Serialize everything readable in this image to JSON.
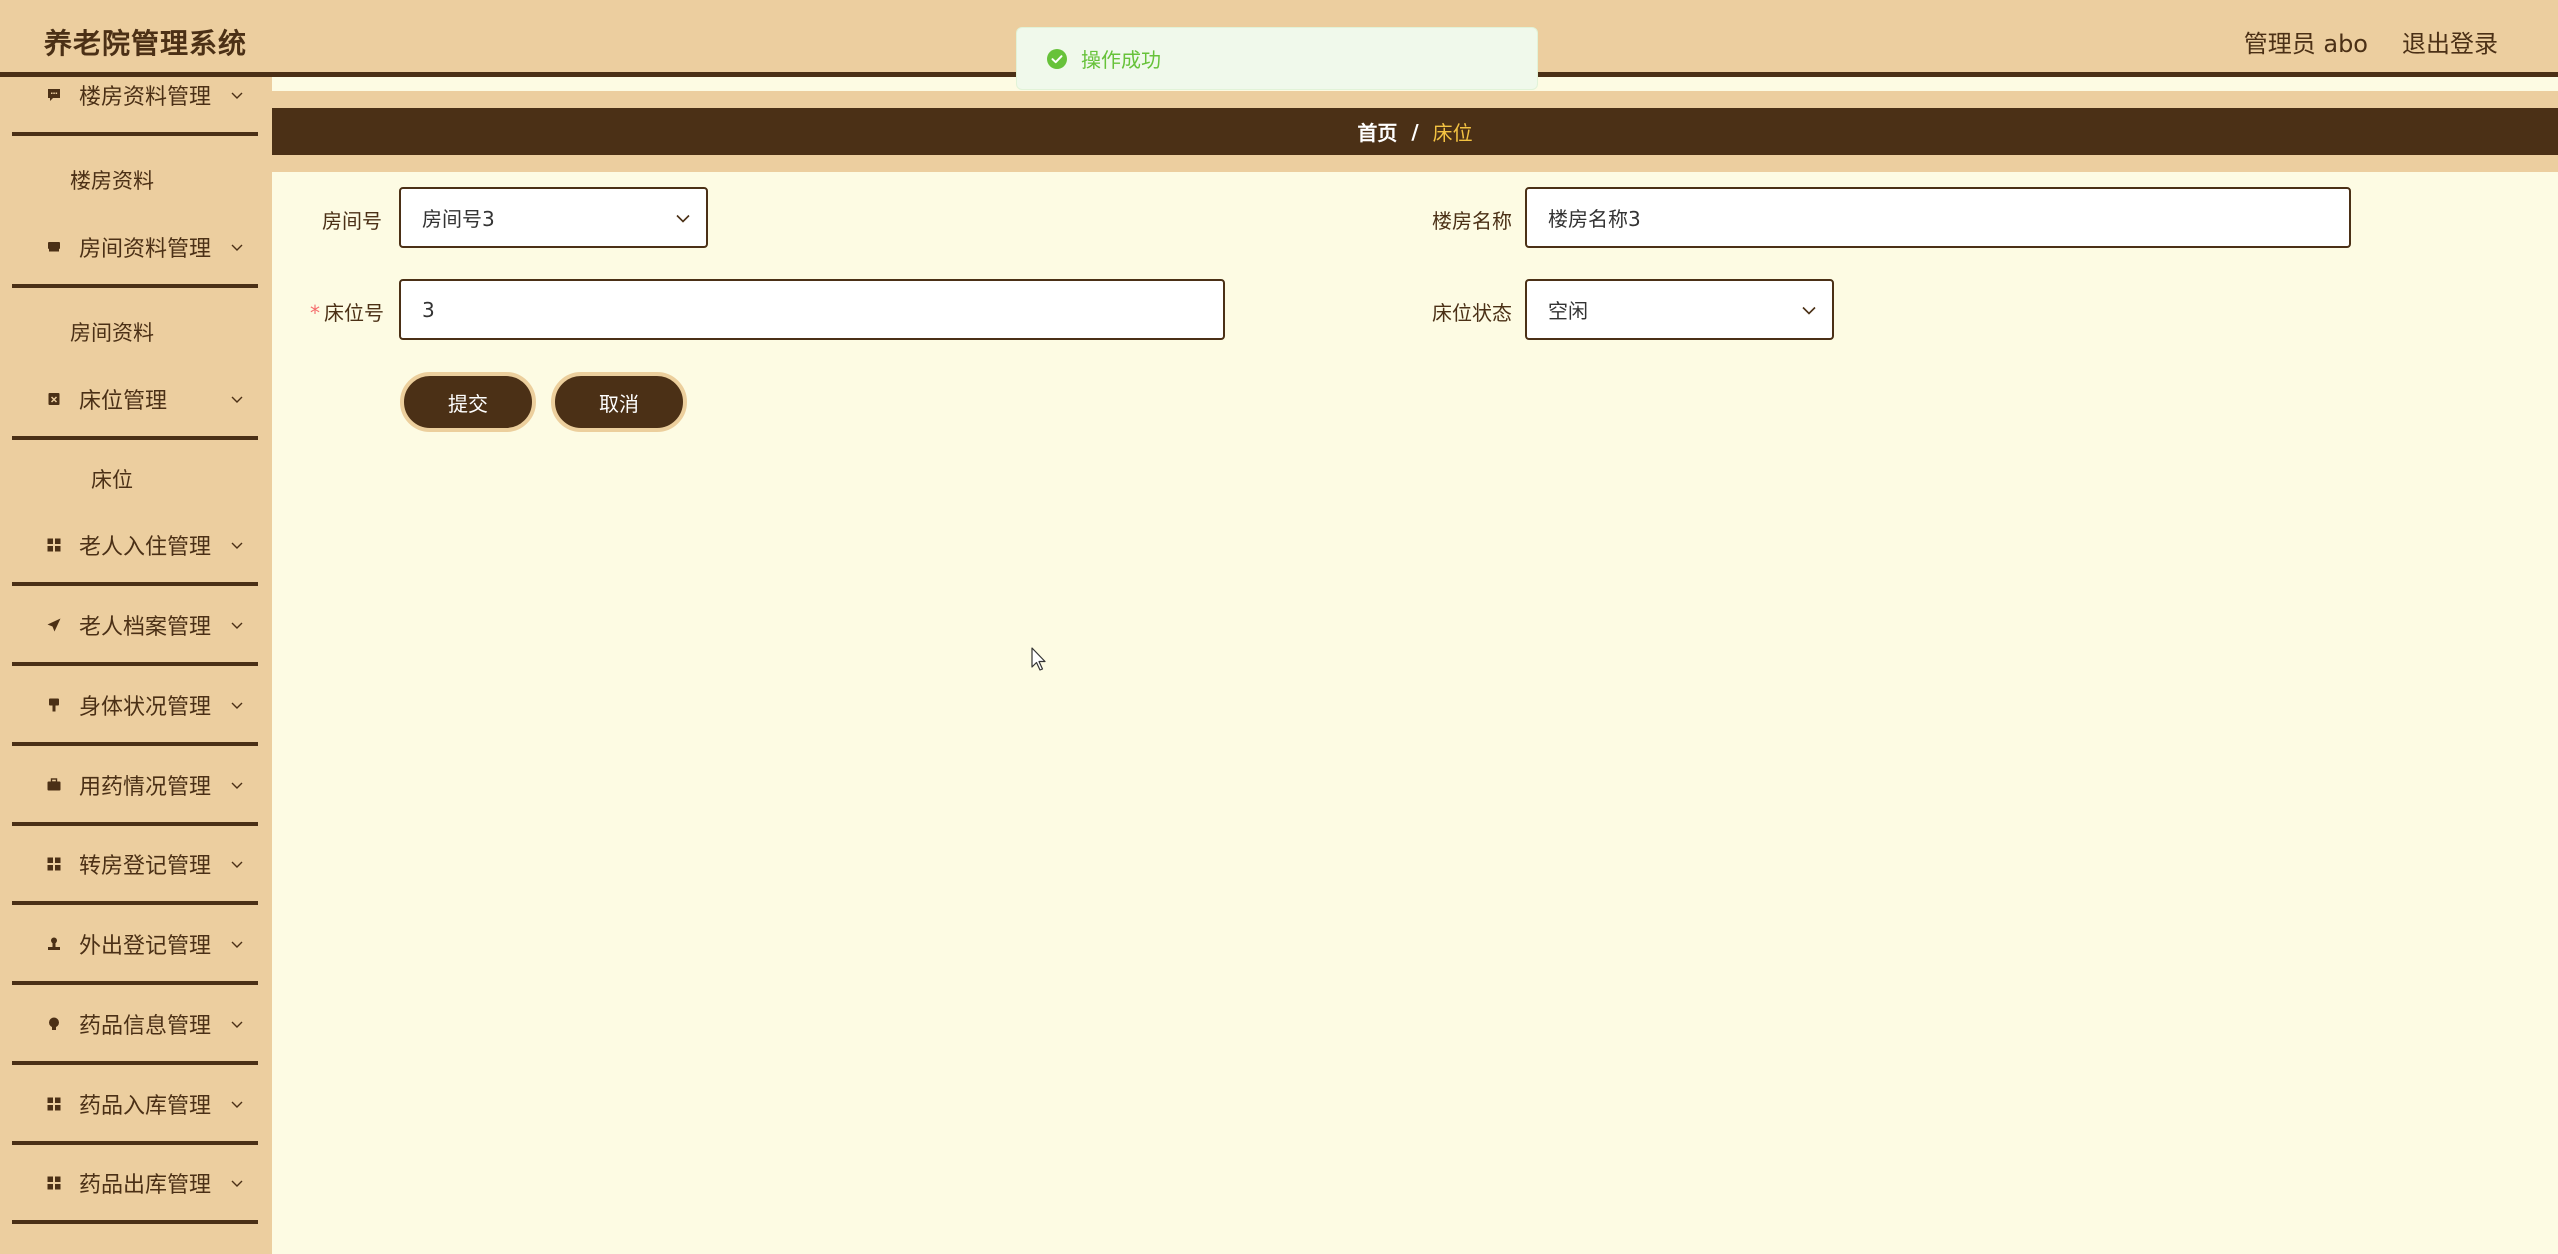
{
  "header": {
    "app_title": "养老院管理系统",
    "user_label": "管理员 abo",
    "logout_label": "退出登录"
  },
  "toast": {
    "message": "操作成功",
    "icon": "success-check-icon",
    "color": "#67c23a"
  },
  "sidebar": {
    "items": [
      {
        "label": "楼房资料管理",
        "icon": "chat-icon",
        "type": "group"
      },
      {
        "label": "楼房资料",
        "type": "sub"
      },
      {
        "label": "房间资料管理",
        "icon": "bed-icon",
        "type": "group"
      },
      {
        "label": "房间资料",
        "type": "sub"
      },
      {
        "label": "床位管理",
        "icon": "calendar-x-icon",
        "type": "group"
      },
      {
        "label": "床位",
        "type": "sub"
      },
      {
        "label": "老人入住管理",
        "icon": "grid-icon",
        "type": "group"
      },
      {
        "label": "老人档案管理",
        "icon": "send-icon",
        "type": "group"
      },
      {
        "label": "身体状况管理",
        "icon": "brush-icon",
        "type": "group"
      },
      {
        "label": "用药情况管理",
        "icon": "briefcase-icon",
        "type": "group"
      },
      {
        "label": "转房登记管理",
        "icon": "grid-icon",
        "type": "group"
      },
      {
        "label": "外出登记管理",
        "icon": "stamp-icon",
        "type": "group"
      },
      {
        "label": "药品信息管理",
        "icon": "bulb-icon",
        "type": "group"
      },
      {
        "label": "药品入库管理",
        "icon": "grid-icon",
        "type": "group"
      },
      {
        "label": "药品出库管理",
        "icon": "grid-icon",
        "type": "group"
      }
    ]
  },
  "breadcrumb": {
    "home": "首页",
    "separator": "/",
    "current": "床位"
  },
  "form": {
    "room_no": {
      "label": "房间号",
      "value": "房间号3"
    },
    "building_name": {
      "label": "楼房名称",
      "value": "楼房名称3"
    },
    "bed_no": {
      "label": "床位号",
      "value": "3",
      "required_mark": "*"
    },
    "bed_status": {
      "label": "床位状态",
      "value": "空闲"
    },
    "submit_label": "提交",
    "cancel_label": "取消"
  },
  "colors": {
    "header_bg": "#ecce9f",
    "dark_brown": "#4b3016",
    "content_bg": "#fdfbe3",
    "breadcrumb_current": "#f3c242"
  }
}
